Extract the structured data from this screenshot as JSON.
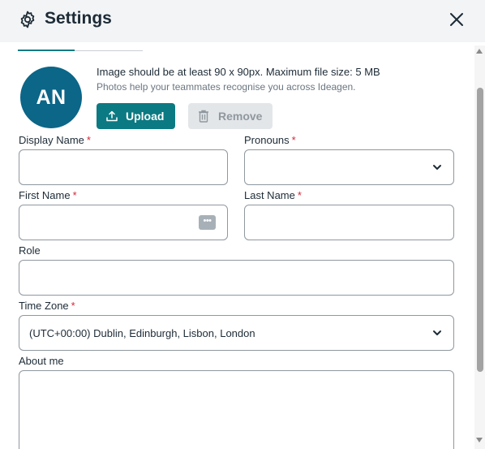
{
  "header": {
    "title": "Settings"
  },
  "avatar": {
    "initials": "AN",
    "color": "#0b6688"
  },
  "photo": {
    "hint": "Image should be at least 90 x 90px. Maximum file size: 5 MB",
    "subhint": "Photos help your teammates recognise you across Ideagen.",
    "upload_label": "Upload",
    "remove_label": "Remove"
  },
  "form": {
    "display_name": {
      "label": "Display Name",
      "required": "*",
      "value": ""
    },
    "pronouns": {
      "label": "Pronouns",
      "required": "*",
      "value": ""
    },
    "first_name": {
      "label": "First Name",
      "required": "*",
      "value": ""
    },
    "last_name": {
      "label": "Last Name",
      "required": "*",
      "value": ""
    },
    "role": {
      "label": "Role",
      "value": ""
    },
    "time_zone": {
      "label": "Time Zone",
      "required": "*",
      "value": "(UTC+00:00) Dublin, Edinburgh, Lisbon, London"
    },
    "about_me": {
      "label": "About me",
      "value": ""
    }
  },
  "colors": {
    "accent": "#0c7a82",
    "required": "#d5263a",
    "header_bg": "#f2f4f6"
  },
  "icons": {
    "settings": "gear-icon",
    "close": "close-icon",
    "upload": "upload-icon",
    "remove": "trash-icon",
    "dropdown": "chevron-down-icon",
    "autofill": "more-dots-icon"
  }
}
